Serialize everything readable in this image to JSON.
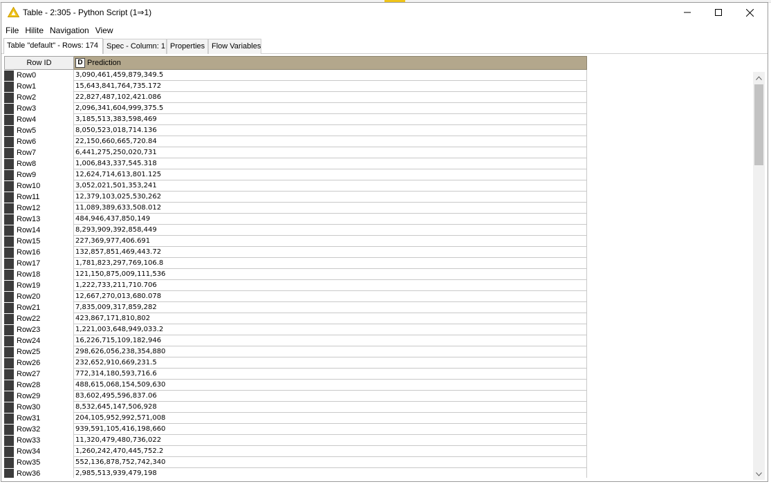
{
  "window": {
    "title": "Table - 2:305 - Python Script (1⇒1)"
  },
  "menu": [
    "File",
    "Hilite",
    "Navigation",
    "View"
  ],
  "tabs": [
    {
      "label": "Table \"default\" - Rows: 174"
    },
    {
      "label": "Spec - Column: 1"
    },
    {
      "label": "Properties"
    },
    {
      "label": "Flow Variables"
    }
  ],
  "table": {
    "rowid_header": "Row ID",
    "column_type": "D",
    "column_header": "Prediction",
    "rows": [
      {
        "id": "Row0",
        "value": "3,090,461,459,879,349.5"
      },
      {
        "id": "Row1",
        "value": "15,643,841,764,735.172"
      },
      {
        "id": "Row2",
        "value": "22,827,487,102,421.086"
      },
      {
        "id": "Row3",
        "value": "2,096,341,604,999,375.5"
      },
      {
        "id": "Row4",
        "value": "3,185,513,383,598,469"
      },
      {
        "id": "Row5",
        "value": "8,050,523,018,714.136"
      },
      {
        "id": "Row6",
        "value": "22,150,660,665,720.84"
      },
      {
        "id": "Row7",
        "value": "6,441,275,250,020,731"
      },
      {
        "id": "Row8",
        "value": "1,006,843,337,545.318"
      },
      {
        "id": "Row9",
        "value": "12,624,714,613,801.125"
      },
      {
        "id": "Row10",
        "value": "3,052,021,501,353,241"
      },
      {
        "id": "Row11",
        "value": "12,379,103,025,530,262"
      },
      {
        "id": "Row12",
        "value": "11,089,389,633,508.012"
      },
      {
        "id": "Row13",
        "value": "484,946,437,850,149"
      },
      {
        "id": "Row14",
        "value": "8,293,909,392,858,449"
      },
      {
        "id": "Row15",
        "value": "227,369,977,406.691"
      },
      {
        "id": "Row16",
        "value": "132,857,851,469,443.72"
      },
      {
        "id": "Row17",
        "value": "1,781,823,297,769,106.8"
      },
      {
        "id": "Row18",
        "value": "121,150,875,009,111,536"
      },
      {
        "id": "Row19",
        "value": "1,222,733,211,710.706"
      },
      {
        "id": "Row20",
        "value": "12,667,270,013,680.078"
      },
      {
        "id": "Row21",
        "value": "7,835,009,317,859,282"
      },
      {
        "id": "Row22",
        "value": "423,867,171,810,802"
      },
      {
        "id": "Row23",
        "value": "1,221,003,648,949,033.2"
      },
      {
        "id": "Row24",
        "value": "16,226,715,109,182,946"
      },
      {
        "id": "Row25",
        "value": "298,626,056,238,354,880"
      },
      {
        "id": "Row26",
        "value": "232,652,910,669,231.5"
      },
      {
        "id": "Row27",
        "value": "772,314,180,593,716.6"
      },
      {
        "id": "Row28",
        "value": "488,615,068,154,509,630"
      },
      {
        "id": "Row29",
        "value": "83,602,495,596,837.06"
      },
      {
        "id": "Row30",
        "value": "8,532,645,147,506,928"
      },
      {
        "id": "Row31",
        "value": "204,105,952,992,571,008"
      },
      {
        "id": "Row32",
        "value": "939,591,105,416,198,660"
      },
      {
        "id": "Row33",
        "value": "11,320,479,480,736,022"
      },
      {
        "id": "Row34",
        "value": "1,260,242,470,445,752.2"
      },
      {
        "id": "Row35",
        "value": "552,136,878,752,742,340"
      },
      {
        "id": "Row36",
        "value": "2,985,513,939,479,198"
      }
    ]
  },
  "colors": {
    "header_column": "#b3a78c",
    "hilite_marker": "#3c3c3c",
    "warning_icon": "#f0c419"
  }
}
